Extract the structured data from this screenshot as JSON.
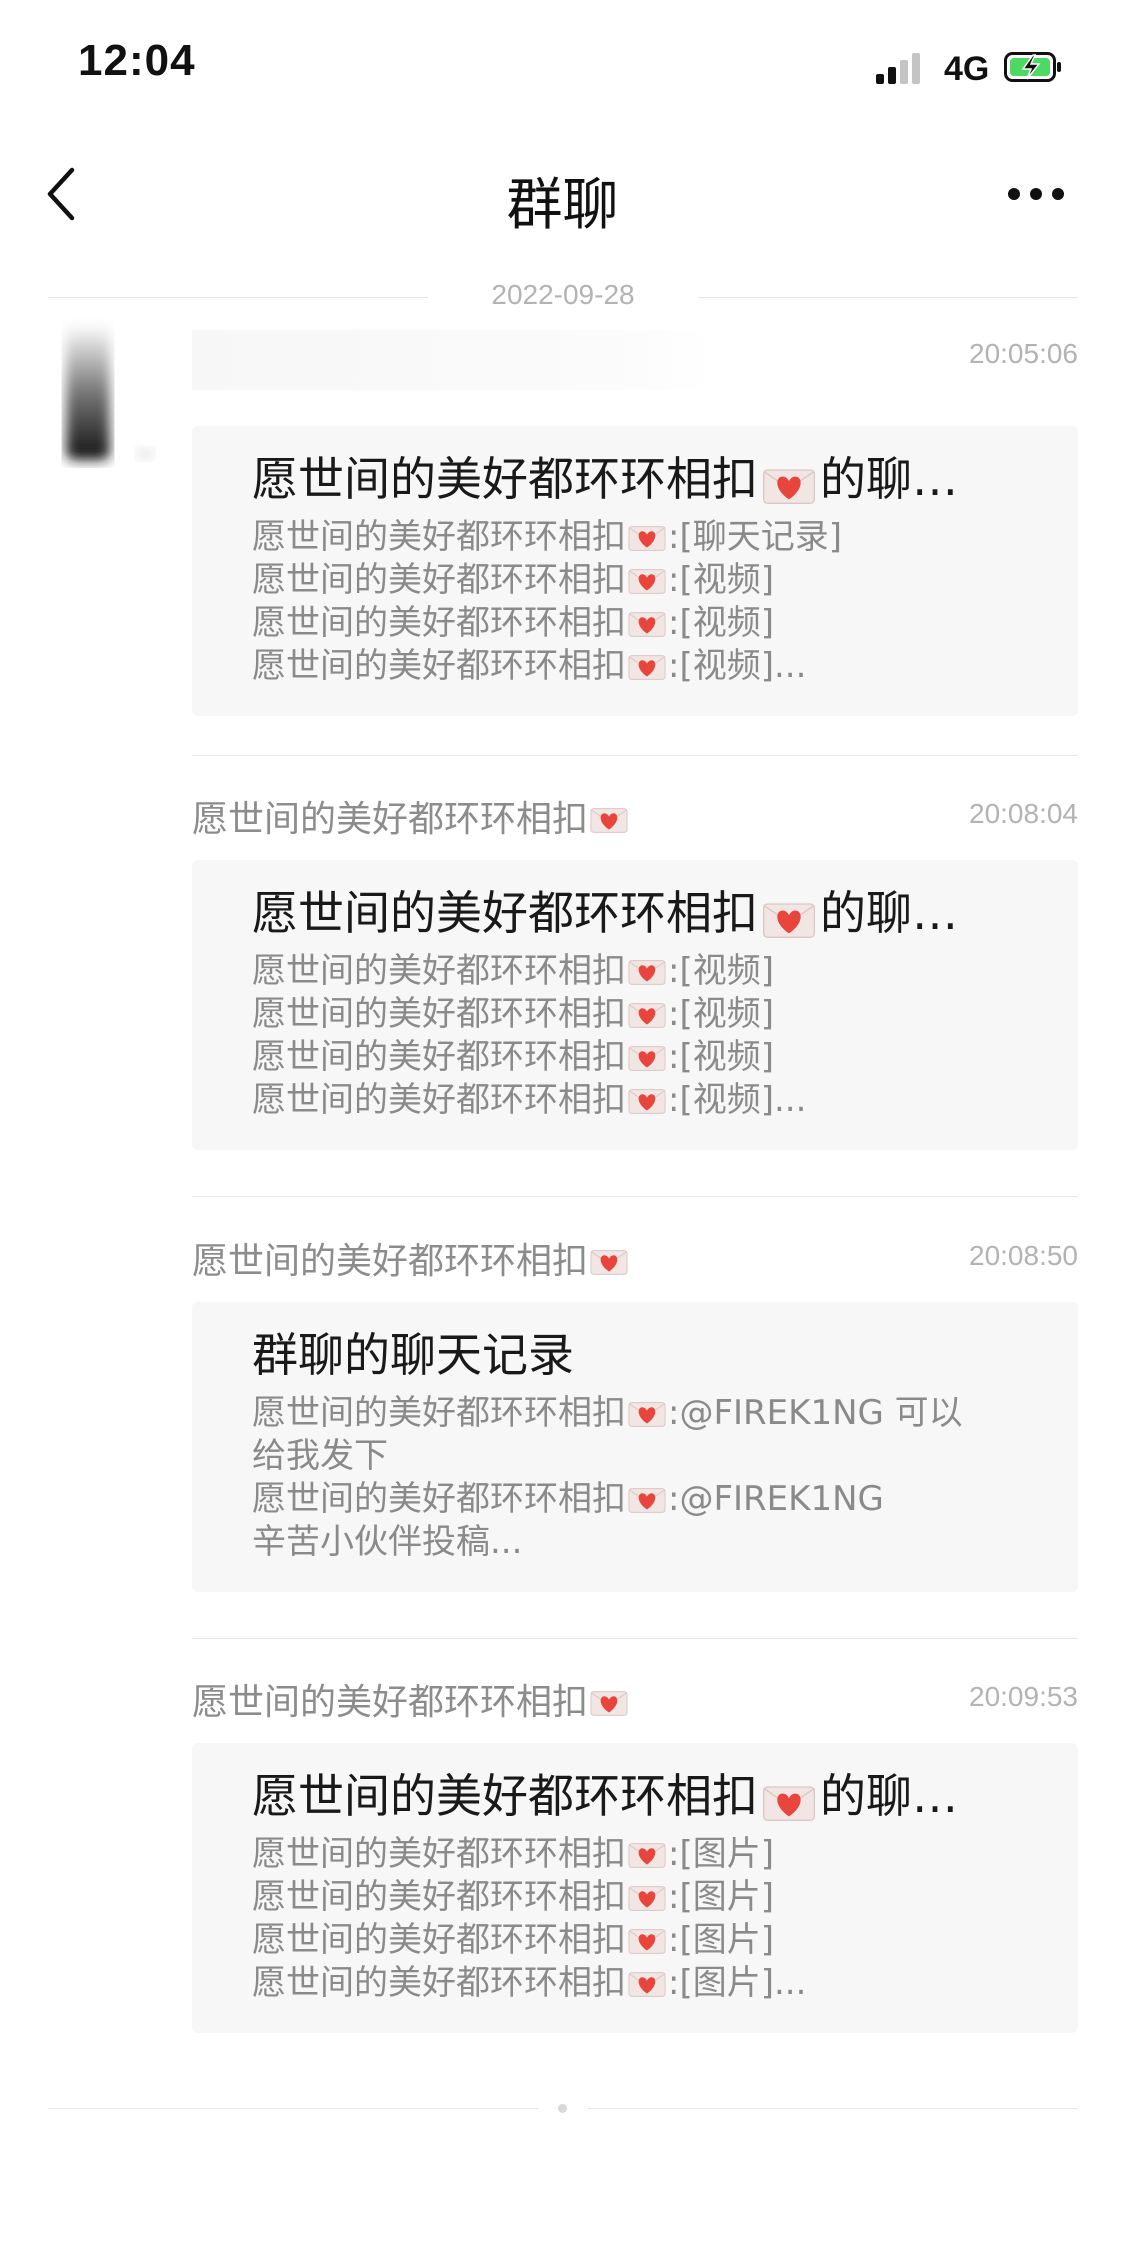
{
  "status_bar": {
    "time": "12:04",
    "network": "4G",
    "battery_charging": true
  },
  "nav": {
    "title": "群聊",
    "back_icon": "chevron-left-icon",
    "more_icon": "ellipsis-icon"
  },
  "date_divider": "2022-09-28",
  "messages": [
    {
      "sender": "",
      "time": "20:05:06",
      "card": {
        "title": "愿世间的美好都环环相扣",
        "title_suffix": "的聊…",
        "lines": [
          {
            "name": "愿世间的美好都环环相扣",
            "content": ":[聊天记录]"
          },
          {
            "name": "愿世间的美好都环环相扣",
            "content": ":[视频]"
          },
          {
            "name": "愿世间的美好都环环相扣",
            "content": ":[视频]"
          },
          {
            "name": "愿世间的美好都环环相扣",
            "content": ":[视频]..."
          }
        ]
      }
    },
    {
      "sender": "愿世间的美好都环环相扣",
      "time": "20:08:04",
      "card": {
        "title": "愿世间的美好都环环相扣",
        "title_suffix": "的聊…",
        "lines": [
          {
            "name": "愿世间的美好都环环相扣",
            "content": ":[视频]"
          },
          {
            "name": "愿世间的美好都环环相扣",
            "content": ":[视频]"
          },
          {
            "name": "愿世间的美好都环环相扣",
            "content": ":[视频]"
          },
          {
            "name": "愿世间的美好都环环相扣",
            "content": ":[视频]..."
          }
        ]
      }
    },
    {
      "sender": "愿世间的美好都环环相扣",
      "time": "20:08:50",
      "card": {
        "title": "群聊的聊天记录",
        "lines": [
          {
            "name": "愿世间的美好都环环相扣",
            "content": ":@FIREK1NG 可以"
          },
          {
            "name": "",
            "content": "给我发下"
          },
          {
            "name": "愿世间的美好都环环相扣",
            "content": ":@FIREK1NG"
          },
          {
            "name": "",
            "content": "辛苦小伙伴投稿..."
          }
        ]
      }
    },
    {
      "sender": "愿世间的美好都环环相扣",
      "time": "20:09:53",
      "card": {
        "title": "愿世间的美好都环环相扣",
        "title_suffix": "的聊…",
        "lines": [
          {
            "name": "愿世间的美好都环环相扣",
            "content": ":[图片]"
          },
          {
            "name": "愿世间的美好都环环相扣",
            "content": ":[图片]"
          },
          {
            "name": "愿世间的美好都环环相扣",
            "content": ":[图片]"
          },
          {
            "name": "愿世间的美好都环环相扣",
            "content": ":[图片]..."
          }
        ]
      }
    }
  ],
  "colors": {
    "heart": "#e8453c",
    "envelope": "#f1e6e4",
    "card_bg": "#f7f7f7",
    "secondary_text": "#8a8a8a"
  }
}
